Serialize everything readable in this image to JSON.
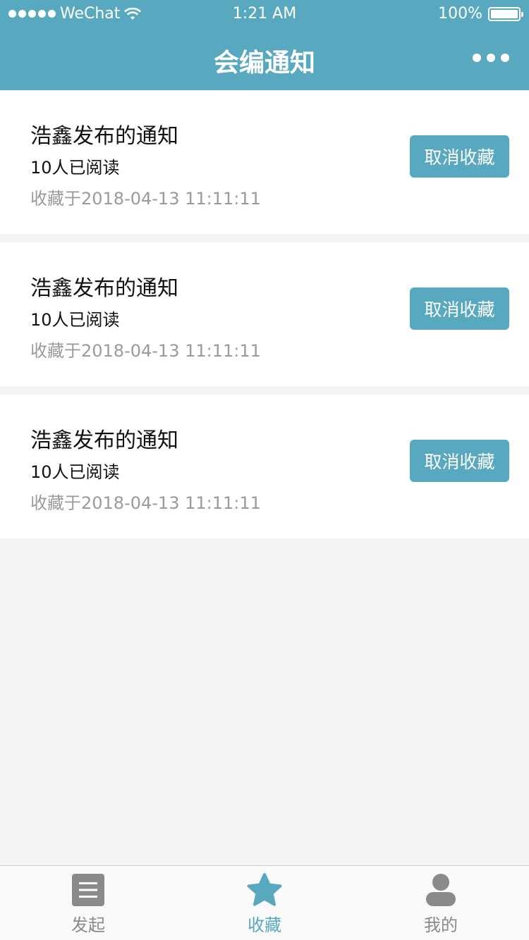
{
  "status_bar": {
    "carrier": "WeChat",
    "time": "1:21 AM",
    "battery": "100%"
  },
  "navbar": {
    "title": "会编通知"
  },
  "notices": [
    {
      "title": "浩鑫发布的通知",
      "reads": "10人已阅读",
      "saved_time": "收藏于2018-04-13 11:11:11",
      "action_label": "取消收藏"
    },
    {
      "title": "浩鑫发布的通知",
      "reads": "10人已阅读",
      "saved_time": "收藏于2018-04-13 11:11:11",
      "action_label": "取消收藏"
    },
    {
      "title": "浩鑫发布的通知",
      "reads": "10人已阅读",
      "saved_time": "收藏于2018-04-13 11:11:11",
      "action_label": "取消收藏"
    }
  ],
  "tabbar": {
    "tabs": [
      {
        "label": "发起",
        "icon": "list-icon",
        "active": false
      },
      {
        "label": "收藏",
        "icon": "star-icon",
        "active": true
      },
      {
        "label": "我的",
        "icon": "user-icon",
        "active": false
      }
    ]
  },
  "colors": {
    "accent": "#58a9bf",
    "inactive_icon": "#8a8a8a",
    "background": "#f3f3f3"
  }
}
